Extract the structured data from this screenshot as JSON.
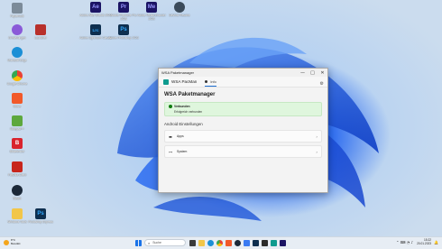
{
  "desktop": {
    "icons": [
      {
        "label": "Papierkorb",
        "glyph": "",
        "color": "#7c8b99"
      },
      {
        "label": "Einstellungen",
        "glyph": "",
        "color": "#8a5ad8"
      },
      {
        "label": "Microsoft Edge",
        "glyph": "",
        "color": "#1b8fd6"
      },
      {
        "label": "Google Chrome",
        "glyph": "",
        "color": "#e94235"
      },
      {
        "label": "Brave",
        "glyph": "",
        "color": "#f1592a"
      },
      {
        "label": "Notepad++",
        "glyph": "",
        "color": "#5da83d"
      },
      {
        "label": "Bitdefender",
        "glyph": "B",
        "color": "#d9232d"
      },
      {
        "label": "FileZilla Client",
        "glyph": "",
        "color": "#c7261d"
      },
      {
        "label": "Steam",
        "glyph": "",
        "color": "#1b2838"
      },
      {
        "label": "Windows Tools",
        "glyph": "",
        "color": "#f2c649"
      },
      {
        "label": "Adobe After Effects 2023",
        "glyph": "Ae",
        "color": "#1b1464"
      },
      {
        "label": "Adobe Premiere Pro 2023",
        "glyph": "Pr",
        "color": "#1b1464"
      },
      {
        "label": "Adobe Media Encoder 2023",
        "glyph": "Me",
        "color": "#1b1464"
      },
      {
        "label": "DaVinci Resolve",
        "glyph": "",
        "color": "#3b4a5a"
      },
      {
        "label": "Adobe Lightroom Classic",
        "glyph": "Lrc",
        "color": "#0e2f4f"
      },
      {
        "label": "Adobe Photoshop 2023",
        "glyph": "Ps",
        "color": "#0e2f4f"
      },
      {
        "label": "Photoshop Express",
        "glyph": "Ps",
        "color": "#0e2f4f"
      },
      {
        "label": "Launcher",
        "glyph": "",
        "color": "#b8302b"
      }
    ]
  },
  "window": {
    "title": "WSA Paketmanager",
    "controls": {
      "minimize": "—",
      "maximize": "□",
      "close": "✕"
    },
    "brand": "WSA PacMan",
    "tab": "Info",
    "settings_icon": "⚙",
    "heading": "WSA Paketmanager",
    "status": {
      "title": "Verbunden",
      "message": "Erfolgreich verbunden"
    },
    "section": "Android Einstellungen",
    "items": [
      {
        "icon": "▬",
        "label": "Apps",
        "chevron": "›"
      },
      {
        "icon": "⊶",
        "label": "System",
        "chevron": "›"
      }
    ]
  },
  "taskbar": {
    "weather": {
      "temp": "8°C",
      "desc": "Bewölkt"
    },
    "search_placeholder": "Suche",
    "search_icon": "⌕",
    "apps": [
      {
        "name": "start",
        "color": "#1a73e8"
      },
      {
        "name": "task-view",
        "color": "#3a3a3a"
      },
      {
        "name": "file-explorer",
        "color": "#f2c649"
      },
      {
        "name": "edge",
        "color": "#1b8fd6"
      },
      {
        "name": "chrome",
        "color": "#e94235"
      },
      {
        "name": "brave",
        "color": "#f1592a"
      },
      {
        "name": "steam",
        "color": "#1b2838"
      },
      {
        "name": "store",
        "color": "#3a7af2"
      },
      {
        "name": "photoshop",
        "color": "#0e2f4f"
      },
      {
        "name": "terminal",
        "color": "#2b2b2b"
      },
      {
        "name": "wsa-pacman",
        "color": "#0e9b8f"
      },
      {
        "name": "premiere",
        "color": "#1b1464"
      }
    ],
    "tray_icons": "⌃  ⌨  ◔  ♪",
    "time": "15:22",
    "date": "20.01.2023",
    "notification_icon": "🔔"
  }
}
